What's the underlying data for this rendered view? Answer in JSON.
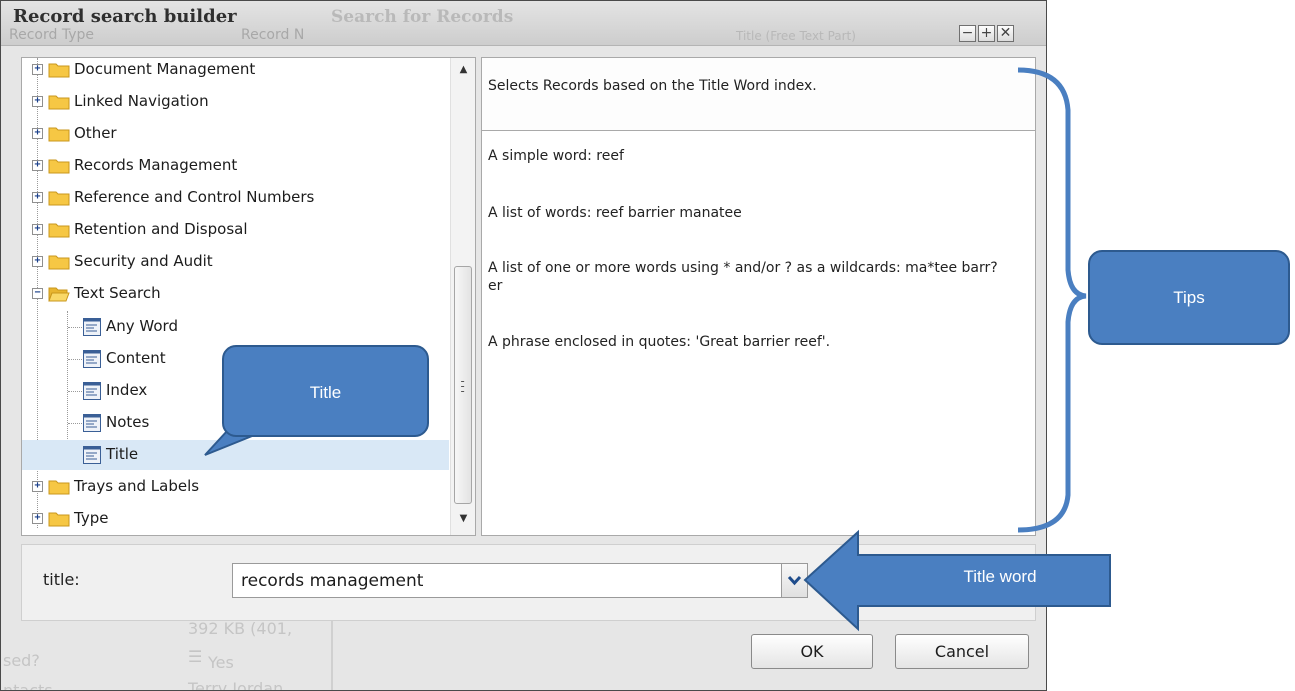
{
  "dialog": {
    "title": "Record search builder",
    "background_title": "Search for Records",
    "background_headers": [
      "Record Type",
      "Record N",
      "Title (Free Text Part)"
    ],
    "window_buttons": {
      "minimize": "−",
      "maximize": "+",
      "close": "✕"
    }
  },
  "tree": {
    "items": [
      {
        "label": "Document Management",
        "state": "collapsed",
        "kind": "folder"
      },
      {
        "label": "Linked Navigation",
        "state": "collapsed",
        "kind": "folder"
      },
      {
        "label": "Other",
        "state": "collapsed",
        "kind": "folder"
      },
      {
        "label": "Records Management",
        "state": "collapsed",
        "kind": "folder"
      },
      {
        "label": "Reference and Control Numbers",
        "state": "collapsed",
        "kind": "folder"
      },
      {
        "label": "Retention and Disposal",
        "state": "collapsed",
        "kind": "folder"
      },
      {
        "label": "Security and Audit",
        "state": "collapsed",
        "kind": "folder"
      },
      {
        "label": "Text Search",
        "state": "expanded",
        "kind": "folder"
      },
      {
        "label": "Any Word",
        "kind": "field"
      },
      {
        "label": "Content",
        "kind": "field"
      },
      {
        "label": "Index",
        "kind": "field"
      },
      {
        "label": "Notes",
        "kind": "field"
      },
      {
        "label": "Title",
        "kind": "field",
        "selected": true
      },
      {
        "label": "Trays and Labels",
        "state": "collapsed",
        "kind": "folder"
      },
      {
        "label": "Type",
        "state": "collapsed",
        "kind": "folder"
      }
    ]
  },
  "help": {
    "summary": "Selects Records based on the Title Word index.",
    "examples": [
      "A simple word: reef",
      "A list of words: reef barrier manatee",
      "A list of one or more words using * and/or ? as a wildcards: ma*tee barr?er",
      "A phrase enclosed in quotes: 'Great barrier reef'."
    ]
  },
  "field": {
    "label": "title:",
    "value": "records management"
  },
  "background": {
    "size_text": "392 KB (401,",
    "yes_text": "Yes",
    "name_text": "Terry Jordan",
    "used_text": "sed?",
    "contacts_text": "ntacts"
  },
  "buttons": {
    "ok": "OK",
    "cancel": "Cancel"
  },
  "annotations": {
    "title_callout": "Title",
    "tips_callout": "Tips",
    "arrow_label": "Title word"
  },
  "colors": {
    "accent_blue": "#4a7fc1",
    "accent_border": "#2d5a8f",
    "selection": "#d9e8f6",
    "folder": "#f6c744"
  }
}
